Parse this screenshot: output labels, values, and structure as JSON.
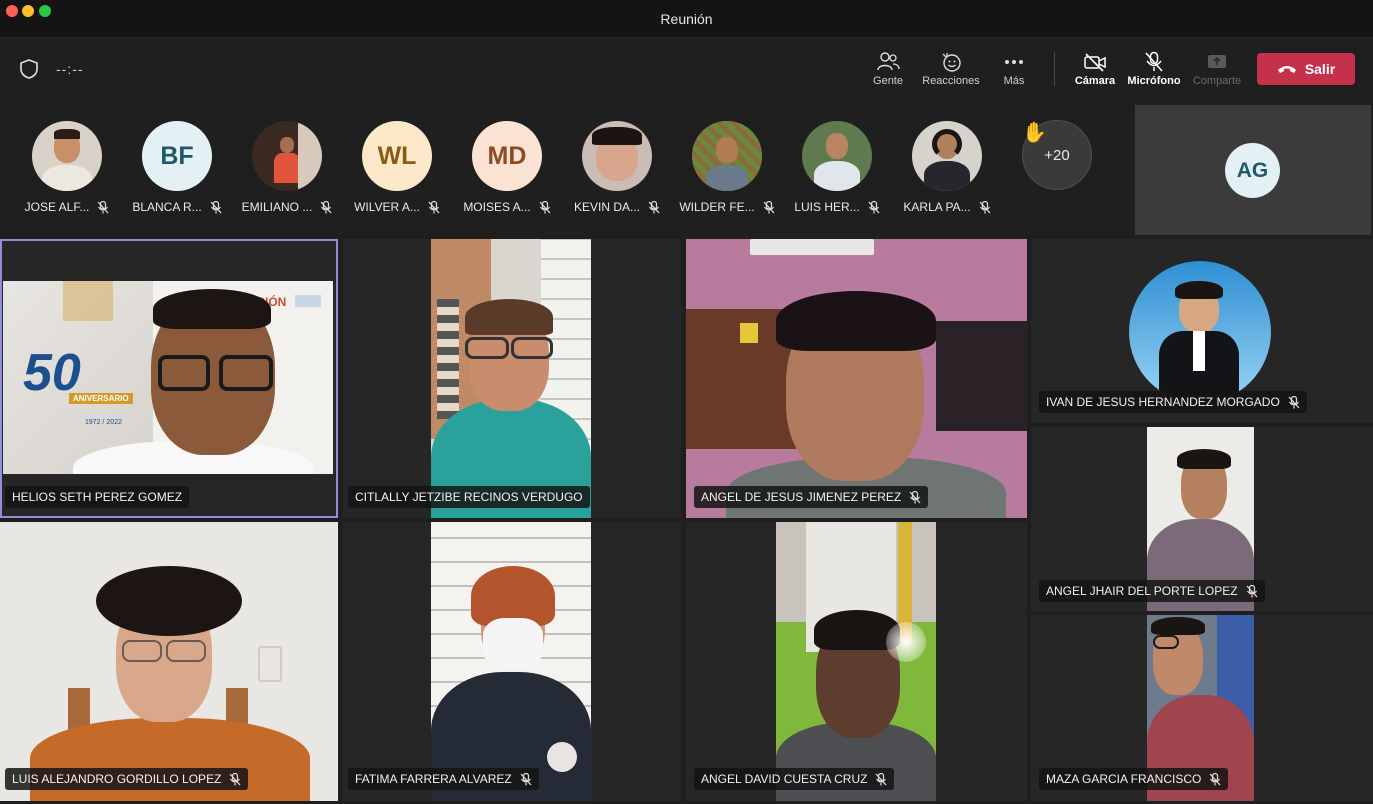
{
  "window": {
    "title": "Reunión"
  },
  "toolbar": {
    "timer": "--:--",
    "people_label": "Gente",
    "reactions_label": "Reacciones",
    "more_label": "Más",
    "camera_label": "Cámara",
    "mic_label": "Micrófono",
    "share_label": "Comparte",
    "leave_label": "Salir"
  },
  "strip": {
    "attendees": [
      {
        "name": "JOSE ALF...",
        "initials": "",
        "muted": true
      },
      {
        "name": "BLANCA R...",
        "initials": "BF",
        "muted": true
      },
      {
        "name": "EMILIANO ...",
        "initials": "",
        "muted": true
      },
      {
        "name": "WILVER A...",
        "initials": "WL",
        "muted": true
      },
      {
        "name": "MOISES A...",
        "initials": "MD",
        "muted": true
      },
      {
        "name": "KEVIN DA...",
        "initials": "",
        "muted": true
      },
      {
        "name": "WILDER FE...",
        "initials": "",
        "muted": true
      },
      {
        "name": "LUIS HER...",
        "initials": "",
        "muted": true
      },
      {
        "name": "KARLA PA...",
        "initials": "",
        "muted": true
      }
    ],
    "overflow_count": "+20",
    "self_initials": "AG"
  },
  "grid": {
    "tiles": [
      {
        "name": "HELIOS SETH PEREZ GOMEZ",
        "muted": false
      },
      {
        "name": "CITLALLY JETZIBE RECINOS VERDUGO",
        "muted": false
      },
      {
        "name": "ANGEL DE JESUS JIMENEZ PEREZ",
        "muted": true
      },
      {
        "name": "IVAN DE JESUS HERNANDEZ MORGADO",
        "muted": true
      },
      {
        "name": "ANGEL JHAIR DEL PORTE LOPEZ",
        "muted": true
      },
      {
        "name": "LUIS ALEJANDRO GORDILLO LOPEZ",
        "muted": true
      },
      {
        "name": "FATIMA FARRERA ALVAREZ",
        "muted": true
      },
      {
        "name": "ANGEL DAVID CUESTA CRUZ",
        "muted": true
      },
      {
        "name": "MAZA GARCIA FRANCISCO",
        "muted": true
      }
    ],
    "slide_text": {
      "number": "50",
      "banner": "ANIVERSARIO",
      "years": "1972 / 2022",
      "heading": "CACIÓN"
    }
  },
  "colors": {
    "leave": "#c4314b",
    "selected_outline": "#8f90d8",
    "background": "#1f1f1f"
  }
}
